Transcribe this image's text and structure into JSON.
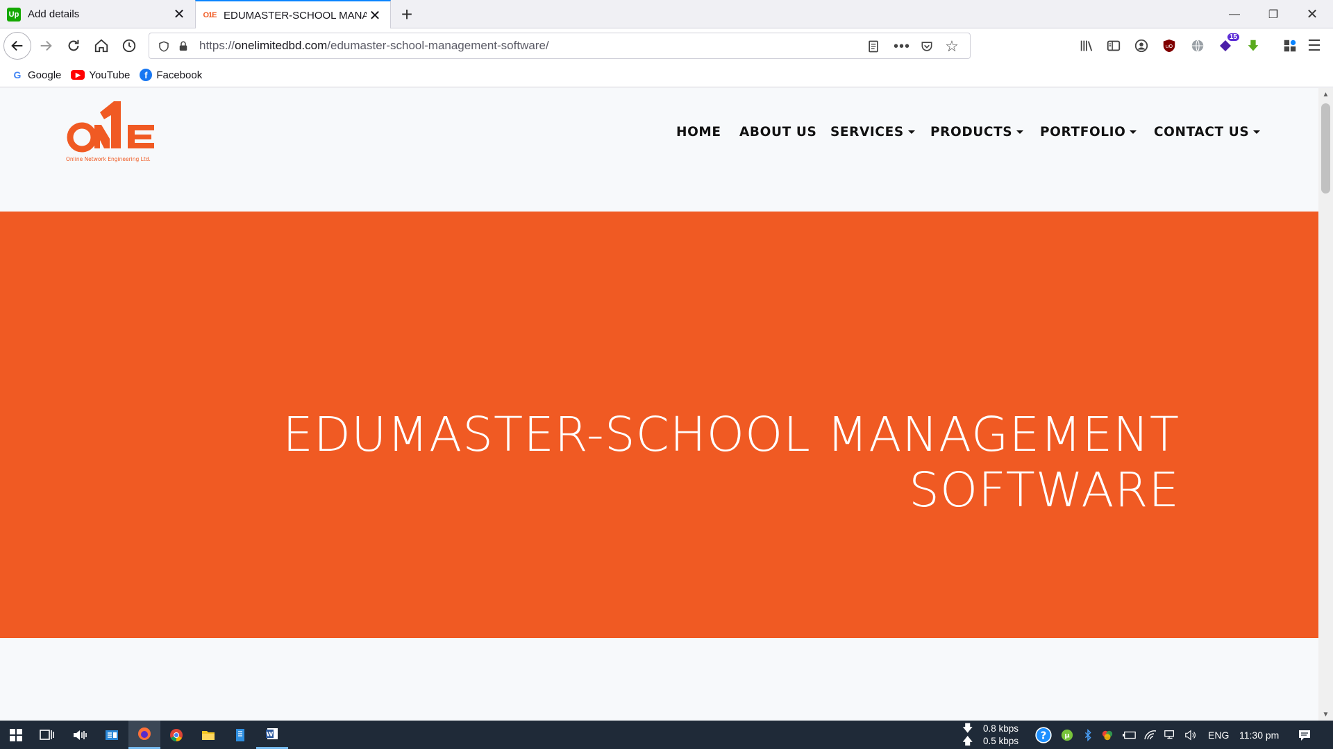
{
  "browser": {
    "tabs": [
      {
        "title": "Add details",
        "favicon": "upwork-icon"
      },
      {
        "title": "EDUMASTER-SCHOOL MANAG",
        "favicon": "one-logo-icon"
      }
    ],
    "url": {
      "scheme": "https://",
      "host": "onelimitedbd.com",
      "path": "/edumaster-school-management-software/"
    },
    "extension_badge": "15",
    "bookmarks": [
      {
        "label": "Google"
      },
      {
        "label": "YouTube"
      },
      {
        "label": "Facebook"
      }
    ]
  },
  "site": {
    "logo_text": "ONE",
    "logo_tagline": "Online Network Engineering Ltd.",
    "nav": [
      {
        "label": "HOME",
        "dropdown": false
      },
      {
        "label": "ABOUT US",
        "dropdown": false
      },
      {
        "label": "SERVICES",
        "dropdown": true
      },
      {
        "label": "PRODUCTS",
        "dropdown": true
      },
      {
        "label": "PORTFOLIO",
        "dropdown": true
      },
      {
        "label": "CONTACT US",
        "dropdown": true
      }
    ],
    "hero": {
      "line1": "EDUMASTER-SCHOOL MANAGEMENT",
      "line2": "SOFTWARE"
    },
    "colors": {
      "accent": "#f05a23",
      "background": "#f7f9fb"
    }
  },
  "taskbar": {
    "download_speed": "0.8 kbps",
    "upload_speed": "0.5 kbps",
    "language": "ENG",
    "time": "11:30 pm"
  }
}
